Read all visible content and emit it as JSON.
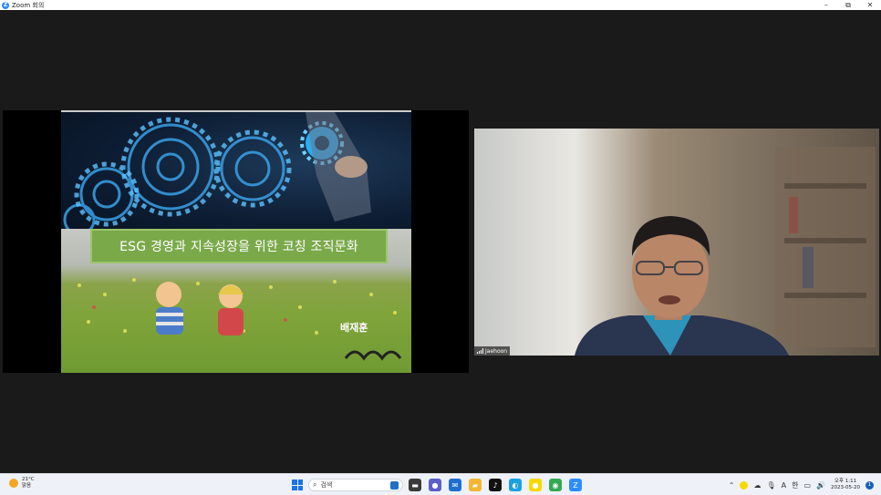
{
  "window": {
    "title": "Zoom 회의",
    "logo_letter": "Z",
    "minimize": "–",
    "maximize": "⧉",
    "close": "✕"
  },
  "share": {
    "slide_title": "ESG 경영과 지속성장을 위한 코칭 조직문화",
    "author": "배재훈"
  },
  "participant": {
    "name": "Jaehoon"
  },
  "taskbar": {
    "weather_temp": "21°C",
    "weather_desc": "맑음",
    "search_placeholder": "검색",
    "clock_time": "오후 1:11",
    "clock_date": "2023-05-20",
    "notification_count": "1",
    "ime_hint": "A",
    "ime_lang": "한",
    "apps": [
      {
        "name": "file-explorer-icon",
        "glyph": "▬",
        "color": "#3a3a3a"
      },
      {
        "name": "chat-icon",
        "glyph": "●",
        "color": "#5b5fc7"
      },
      {
        "name": "mail-icon",
        "glyph": "✉",
        "color": "#1f6fd1"
      },
      {
        "name": "folder-icon",
        "glyph": "▰",
        "color": "#f2b632"
      },
      {
        "name": "tiktok-icon",
        "glyph": "♪",
        "color": "#111111"
      },
      {
        "name": "edge-icon",
        "glyph": "◐",
        "color": "#1ba1e2"
      },
      {
        "name": "kakaotalk-icon",
        "glyph": "●",
        "color": "#f7d900"
      },
      {
        "name": "chrome-icon",
        "glyph": "◉",
        "color": "#34a853"
      },
      {
        "name": "zoom-icon",
        "glyph": "Z",
        "color": "#2d8cff"
      }
    ]
  }
}
